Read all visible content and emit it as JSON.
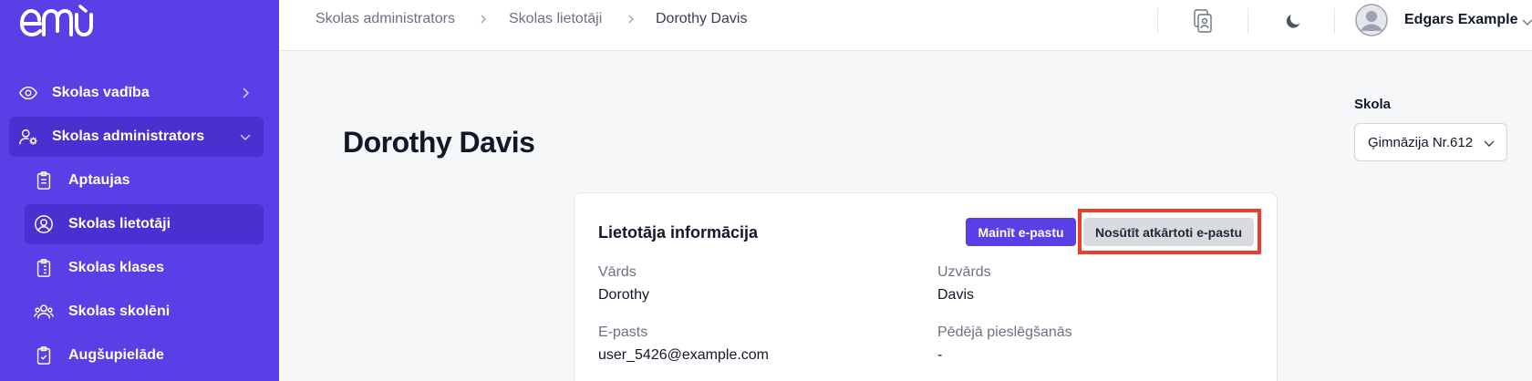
{
  "app": {
    "logo_text": "emu"
  },
  "sidebar": {
    "items": [
      {
        "label": "Skolas vadība"
      },
      {
        "label": "Skolas administrators"
      }
    ],
    "sub_items": [
      {
        "label": "Aptaujas"
      },
      {
        "label": "Skolas lietotāji"
      },
      {
        "label": "Skolas klases"
      },
      {
        "label": "Skolas skolēni"
      },
      {
        "label": "Augšupielāde"
      }
    ]
  },
  "breadcrumb": [
    "Skolas administrators",
    "Skolas lietotāji",
    "Dorothy Davis"
  ],
  "user": {
    "name": "Edgars Example"
  },
  "page": {
    "title": "Dorothy Davis"
  },
  "school": {
    "label": "Skola",
    "selected": "Ģimnāzija Nr.612"
  },
  "card": {
    "title": "Lietotāja informācija",
    "change_email_label": "Mainīt e-pastu",
    "resend_email_label": "Nosūtīt atkārtoti e-pastu",
    "fields": [
      {
        "label": "Vārds",
        "value": "Dorothy"
      },
      {
        "label": "Uzvārds",
        "value": "Davis"
      },
      {
        "label": "E-pasts",
        "value": "user_5426@example.com"
      },
      {
        "label": "Pēdējā pieslēgšanās",
        "value": "-"
      }
    ]
  },
  "colors": {
    "sidebar": "#5a3ee6",
    "sidebar_active": "#4a2fd1",
    "accent": "#5a3ee6",
    "highlight": "#e8402a"
  }
}
